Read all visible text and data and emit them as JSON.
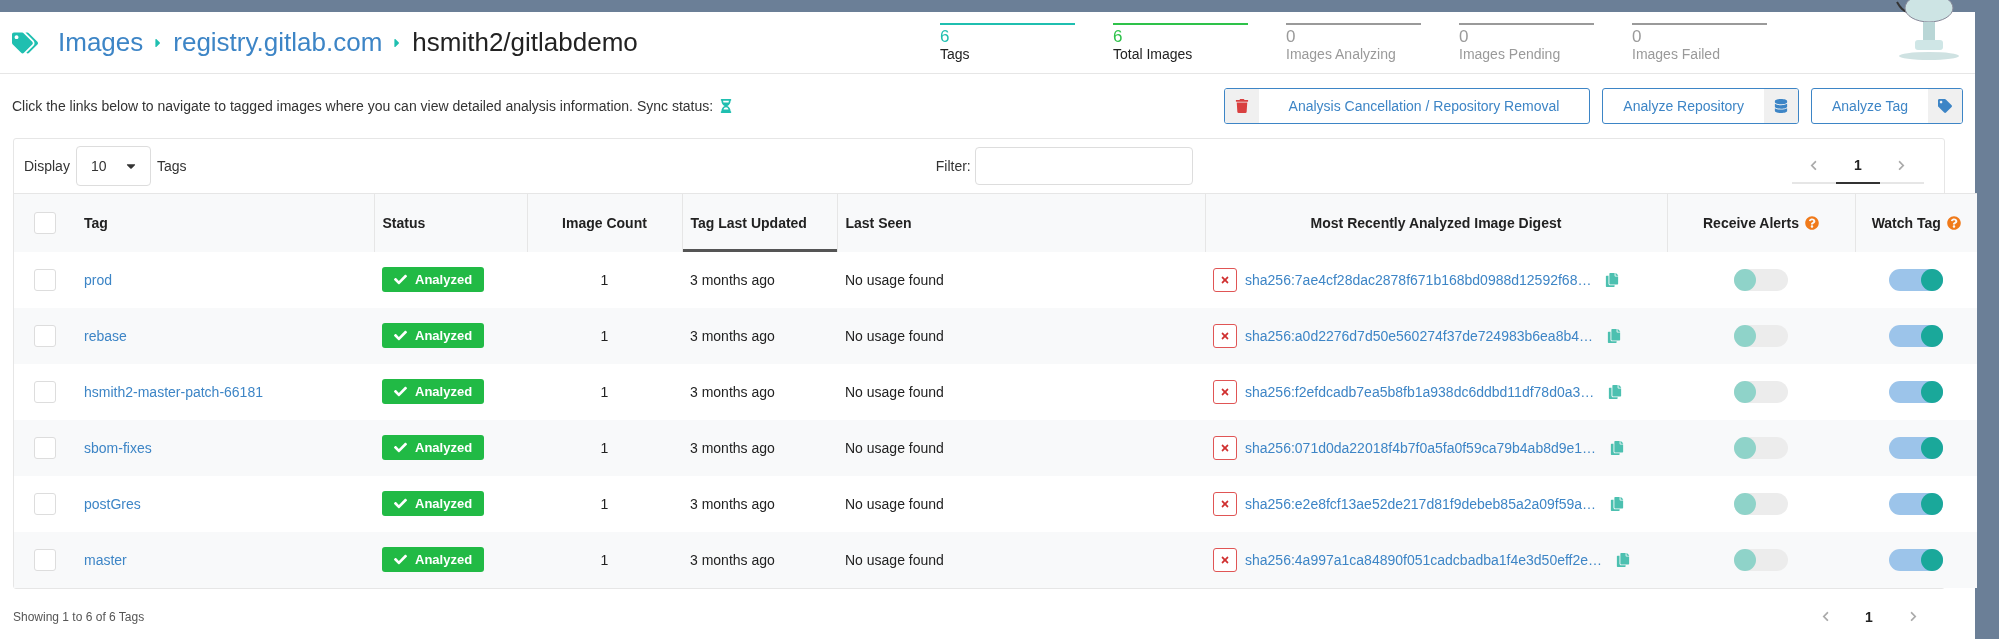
{
  "breadcrumb": [
    {
      "label": "Images",
      "link": true
    },
    {
      "label": "registry.gitlab.com",
      "link": true
    },
    {
      "label": "hsmith2/gitlabdemo",
      "link": false
    }
  ],
  "stats": [
    {
      "value": "6",
      "label": "Tags",
      "color": "#1fbfb0",
      "active": true
    },
    {
      "value": "6",
      "label": "Total Images",
      "color": "#2ec24a",
      "active": true
    },
    {
      "value": "0",
      "label": "Images Analyzing",
      "color": "#9a9a9a",
      "active": false
    },
    {
      "value": "0",
      "label": "Images Pending",
      "color": "#9a9a9a",
      "active": false
    },
    {
      "value": "0",
      "label": "Images Failed",
      "color": "#9a9a9a",
      "active": false
    }
  ],
  "info": "Click the links below to navigate to tagged images where you can view detailed analysis information. Sync status:",
  "actions": [
    {
      "label": "Analysis Cancellation / Repository Removal",
      "kind": "trash"
    },
    {
      "label": "Analyze Repository",
      "kind": "database"
    },
    {
      "label": "Analyze Tag",
      "kind": "tag"
    }
  ],
  "display": {
    "label": "Display",
    "value": "10",
    "suffix": "Tags"
  },
  "filter": {
    "label": "Filter:"
  },
  "pagination": [
    {
      "label": "1",
      "selected": true
    }
  ],
  "columns": [
    {
      "label": "Tag",
      "sorted": false,
      "help": false
    },
    {
      "label": "Status",
      "sorted": false,
      "help": false
    },
    {
      "label": "Image Count",
      "sorted": false,
      "help": false
    },
    {
      "label": "Tag Last Updated",
      "sorted": true,
      "help": false
    },
    {
      "label": "Last Seen",
      "sorted": false,
      "help": false
    },
    {
      "label": "Most Recently Analyzed Image Digest",
      "sorted": false,
      "help": false
    },
    {
      "label": "Receive Alerts",
      "sorted": false,
      "help": true
    },
    {
      "label": "Watch Tag",
      "sorted": false,
      "help": true
    }
  ],
  "header_checked": false,
  "rows": [
    {
      "checked": false,
      "tag": "prod",
      "status": "Analyzed",
      "count": "1",
      "updated": "3 months ago",
      "seen": "No usage found",
      "digest": "sha256:7ae4cf28dac2878f671b168bd0988d12592f68…",
      "alerts": false,
      "watch": true
    },
    {
      "checked": false,
      "tag": "rebase",
      "status": "Analyzed",
      "count": "1",
      "updated": "3 months ago",
      "seen": "No usage found",
      "digest": "sha256:a0d2276d7d50e560274f37de724983b6ea8b4…",
      "alerts": false,
      "watch": true
    },
    {
      "checked": false,
      "tag": "hsmith2-master-patch-66181",
      "status": "Analyzed",
      "count": "1",
      "updated": "3 months ago",
      "seen": "No usage found",
      "digest": "sha256:f2efdcadb7ea5b8fb1a938dc6ddbd11df78d0a3…",
      "alerts": false,
      "watch": true
    },
    {
      "checked": false,
      "tag": "sbom-fixes",
      "status": "Analyzed",
      "count": "1",
      "updated": "3 months ago",
      "seen": "No usage found",
      "digest": "sha256:071d0da22018f4b7f0a5fa0f59ca79b4ab8d9e1…",
      "alerts": false,
      "watch": true
    },
    {
      "checked": false,
      "tag": "postGres",
      "status": "Analyzed",
      "count": "1",
      "updated": "3 months ago",
      "seen": "No usage found",
      "digest": "sha256:e2e8fcf13ae52de217d81f9debeb85a2a09f59a…",
      "alerts": false,
      "watch": true
    },
    {
      "checked": false,
      "tag": "master",
      "status": "Analyzed",
      "count": "1",
      "updated": "3 months ago",
      "seen": "No usage found",
      "digest": "sha256:4a997a1ca84890f051cadcbadba1f4e3d50eff2e…",
      "alerts": false,
      "watch": true
    }
  ],
  "footer": "Showing 1 to 6 of 6 Tags",
  "footer_pagination": [
    {
      "label": "1",
      "selected": true
    }
  ]
}
